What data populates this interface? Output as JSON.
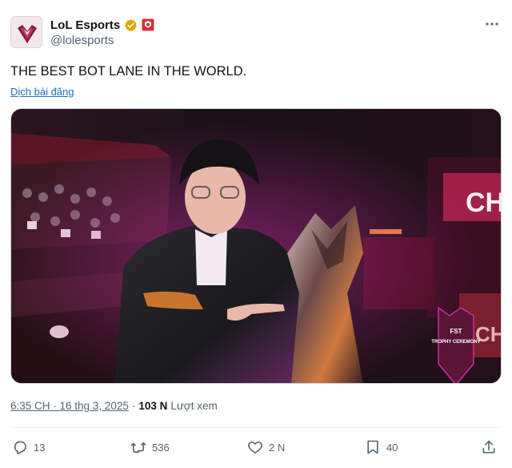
{
  "account": {
    "display_name": "LoL Esports",
    "handle": "@lolesports",
    "verified_color": "#e2a400",
    "affiliate_badge_color": "#d92f3a"
  },
  "tweet": {
    "text": "THE BEST BOT LANE IN THE WORLD.",
    "translate_label": "Dịch bài đăng"
  },
  "media": {
    "overlay_lines": [
      "FST",
      "TROPHY CEREMONY"
    ],
    "brand_colors": {
      "magenta": "#c82ea8",
      "dark": "#1c1118"
    }
  },
  "meta": {
    "time": "6:35 CH · 16 thg 3, 2025",
    "separator": "·",
    "views_count": "103 N",
    "views_label": "Lượt xem"
  },
  "actions": {
    "replies": "13",
    "reposts": "536",
    "likes": "2 N",
    "bookmarks": "40"
  },
  "icons": [
    "more-icon",
    "verified-badge-icon",
    "affiliate-badge-icon",
    "reply-icon",
    "repost-icon",
    "like-icon",
    "bookmark-icon",
    "share-icon"
  ]
}
